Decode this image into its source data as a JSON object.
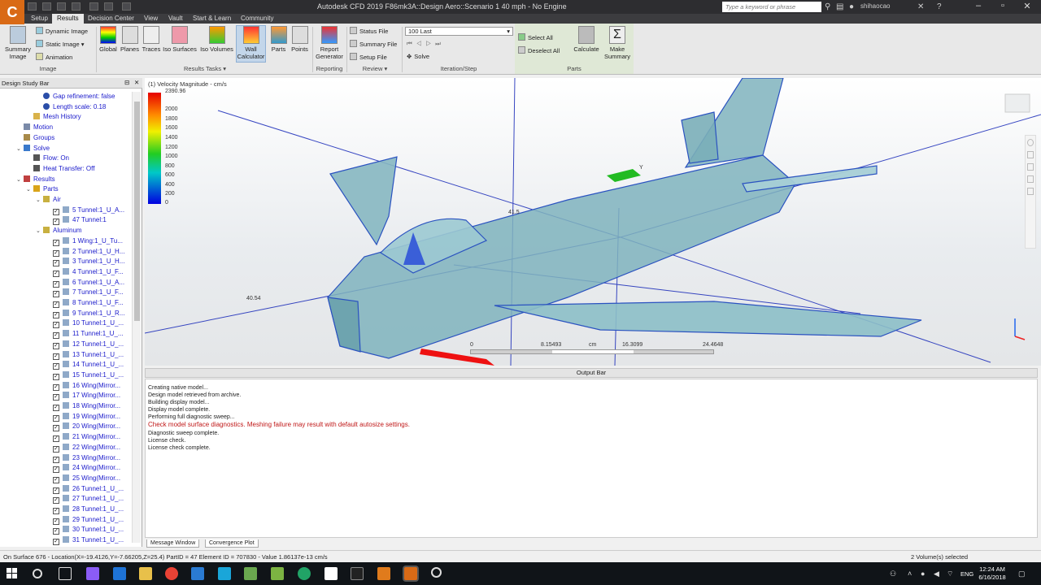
{
  "app": {
    "logo_letter": "C",
    "window_title": "Autodesk CFD 2019   F86mk3A::Design Aero::Scenario 1 40 mph - No Engine",
    "search_placeholder": "Type a keyword or phrase",
    "user": "shihaocao"
  },
  "menu_tabs": [
    "Setup",
    "Results",
    "Decision Center",
    "View",
    "Vault",
    "Start & Learn",
    "Community"
  ],
  "active_tab": "Results",
  "ribbon": {
    "summary_image": "Summary Image",
    "dynamic_image": "Dynamic Image",
    "static_image": "Static Image",
    "animation": "Animation",
    "image_group": "Image",
    "global": "Global",
    "planes": "Planes",
    "traces": "Traces",
    "iso_surfaces": "Iso Surfaces",
    "iso_volumes": "Iso Volumes",
    "wall_calculator_1": "Wall",
    "wall_calculator_2": "Calculator",
    "parts": "Parts",
    "points": "Points",
    "results_tasks_group": "Results Tasks",
    "report_generator_1": "Report",
    "report_generator_2": "Generator",
    "reporting_group": "Reporting",
    "status_file": "Status File",
    "summary_file": "Summary File",
    "setup_file": "Setup File",
    "review_group": "Review",
    "step_value": "100 Last",
    "solve": "Solve",
    "iteration_group": "Iteration/Step",
    "select_all": "Select All",
    "deselect_all": "Deselect All",
    "calculate": "Calculate",
    "make_summary_1": "Make",
    "make_summary_2": "Summary",
    "parts_group": "Parts"
  },
  "design_study_bar": {
    "title": "Design Study Bar",
    "items": [
      {
        "label": "Gap refinement: false",
        "level": 4,
        "icon": "info"
      },
      {
        "label": "Length scale: 0.18",
        "level": 4,
        "icon": "info"
      },
      {
        "label": "Mesh History",
        "level": 3,
        "icon": "mesh"
      },
      {
        "label": "Motion",
        "level": 2,
        "icon": "motion"
      },
      {
        "label": "Groups",
        "level": 2,
        "icon": "groups"
      },
      {
        "label": "Solve",
        "level": 2,
        "icon": "solve",
        "expanded": true
      },
      {
        "label": "Flow: On",
        "level": 3,
        "icon": "flow"
      },
      {
        "label": "Heat Transfer: Off",
        "level": 3,
        "icon": "heat"
      },
      {
        "label": "Results",
        "level": 2,
        "icon": "results",
        "expanded": true
      },
      {
        "label": "Parts",
        "level": 3,
        "icon": "parts",
        "expanded": true
      },
      {
        "label": "Air",
        "level": 4,
        "icon": "material",
        "expanded": true
      },
      {
        "label": "5 Tunnel:1_U_A...",
        "level": 5,
        "check": true
      },
      {
        "label": "47 Tunnel:1",
        "level": 5,
        "check": true
      },
      {
        "label": "Aluminum",
        "level": 4,
        "icon": "material",
        "expanded": true
      },
      {
        "label": "1 Wing:1_U_Tu...",
        "level": 5,
        "check": true
      },
      {
        "label": "2 Tunnel:1_U_H...",
        "level": 5,
        "check": true
      },
      {
        "label": "3 Tunnel:1_U_H...",
        "level": 5,
        "check": true
      },
      {
        "label": "4 Tunnel:1_U_F...",
        "level": 5,
        "check": true
      },
      {
        "label": "6 Tunnel:1_U_A...",
        "level": 5,
        "check": true
      },
      {
        "label": "7 Tunnel:1_U_F...",
        "level": 5,
        "check": true
      },
      {
        "label": "8 Tunnel:1_U_F...",
        "level": 5,
        "check": true
      },
      {
        "label": "9 Tunnel:1_U_R...",
        "level": 5,
        "check": true
      },
      {
        "label": "10 Tunnel:1_U_...",
        "level": 5,
        "check": true
      },
      {
        "label": "11 Tunnel:1_U_...",
        "level": 5,
        "check": true
      },
      {
        "label": "12 Tunnel:1_U_...",
        "level": 5,
        "check": true
      },
      {
        "label": "13 Tunnel:1_U_...",
        "level": 5,
        "check": true
      },
      {
        "label": "14 Tunnel:1_U_...",
        "level": 5,
        "check": true
      },
      {
        "label": "15 Tunnel:1_U_...",
        "level": 5,
        "check": true
      },
      {
        "label": "16 Wing(Mirror...",
        "level": 5,
        "check": true
      },
      {
        "label": "17 Wing(Mirror...",
        "level": 5,
        "check": true
      },
      {
        "label": "18 Wing(Mirror...",
        "level": 5,
        "check": true
      },
      {
        "label": "19 Wing(Mirror...",
        "level": 5,
        "check": true
      },
      {
        "label": "20 Wing(Mirror...",
        "level": 5,
        "check": true
      },
      {
        "label": "21 Wing(Mirror...",
        "level": 5,
        "check": true
      },
      {
        "label": "22 Wing(Mirror...",
        "level": 5,
        "check": true
      },
      {
        "label": "23 Wing(Mirror...",
        "level": 5,
        "check": true
      },
      {
        "label": "24 Wing(Mirror...",
        "level": 5,
        "check": true
      },
      {
        "label": "25 Wing(Mirror...",
        "level": 5,
        "check": true
      },
      {
        "label": "26 Tunnel:1_U_...",
        "level": 5,
        "check": true
      },
      {
        "label": "27 Tunnel:1_U_...",
        "level": 5,
        "check": true
      },
      {
        "label": "28 Tunnel:1_U_...",
        "level": 5,
        "check": true
      },
      {
        "label": "29 Tunnel:1_U_...",
        "level": 5,
        "check": true
      },
      {
        "label": "30 Tunnel:1_U_...",
        "level": 5,
        "check": true
      },
      {
        "label": "31 Tunnel:1_U_...",
        "level": 5,
        "check": true
      }
    ]
  },
  "viewport": {
    "label": "(1) Velocity Magnitude - cm/s",
    "legend_max": "2390.96",
    "legend_ticks": [
      "2000",
      "1800",
      "1600",
      "1400",
      "1200",
      "1000",
      "800",
      "600",
      "400",
      "200",
      "0"
    ],
    "probe_y": "Y",
    "probe_a": "40.54",
    "probe_b": "41.5",
    "scale": [
      "0",
      "8.15493",
      "cm",
      "16.3099",
      "24.4648"
    ]
  },
  "output": {
    "title": "Output Bar",
    "lines": [
      {
        "text": "Creating native model...",
        "warn": false
      },
      {
        "text": "Design model retrieved from archive.",
        "warn": false
      },
      {
        "text": "Building display model...",
        "warn": false
      },
      {
        "text": "Display model complete.",
        "warn": false
      },
      {
        "text": "Performing full diagnostic sweep...",
        "warn": false
      },
      {
        "text": "Check model surface diagnostics. Meshing failure may result with default autosize settings.",
        "warn": true
      },
      {
        "text": "Diagnostic sweep complete.",
        "warn": false
      },
      {
        "text": "License check.",
        "warn": false
      },
      {
        "text": "License check complete.",
        "warn": false
      }
    ],
    "tabs": [
      "Message Window",
      "Convergence Plot"
    ]
  },
  "status": {
    "left": "On Surface 676 - Location(X=-19.4126,Y=-7.66205,Z=25.4) PartID = 47 Element ID = 707830 - Value 1.86137e-13  cm/s",
    "right": "2 Volume(s) selected"
  },
  "taskbar": {
    "time": "12:24 AM",
    "date": "6/16/2018",
    "lang": "ENG"
  },
  "colors": {
    "app_orange": "#d96a16",
    "titlebar": "#2d2d30",
    "aircraft": "#7fb3bd",
    "blue_lines": "#2233bb"
  }
}
